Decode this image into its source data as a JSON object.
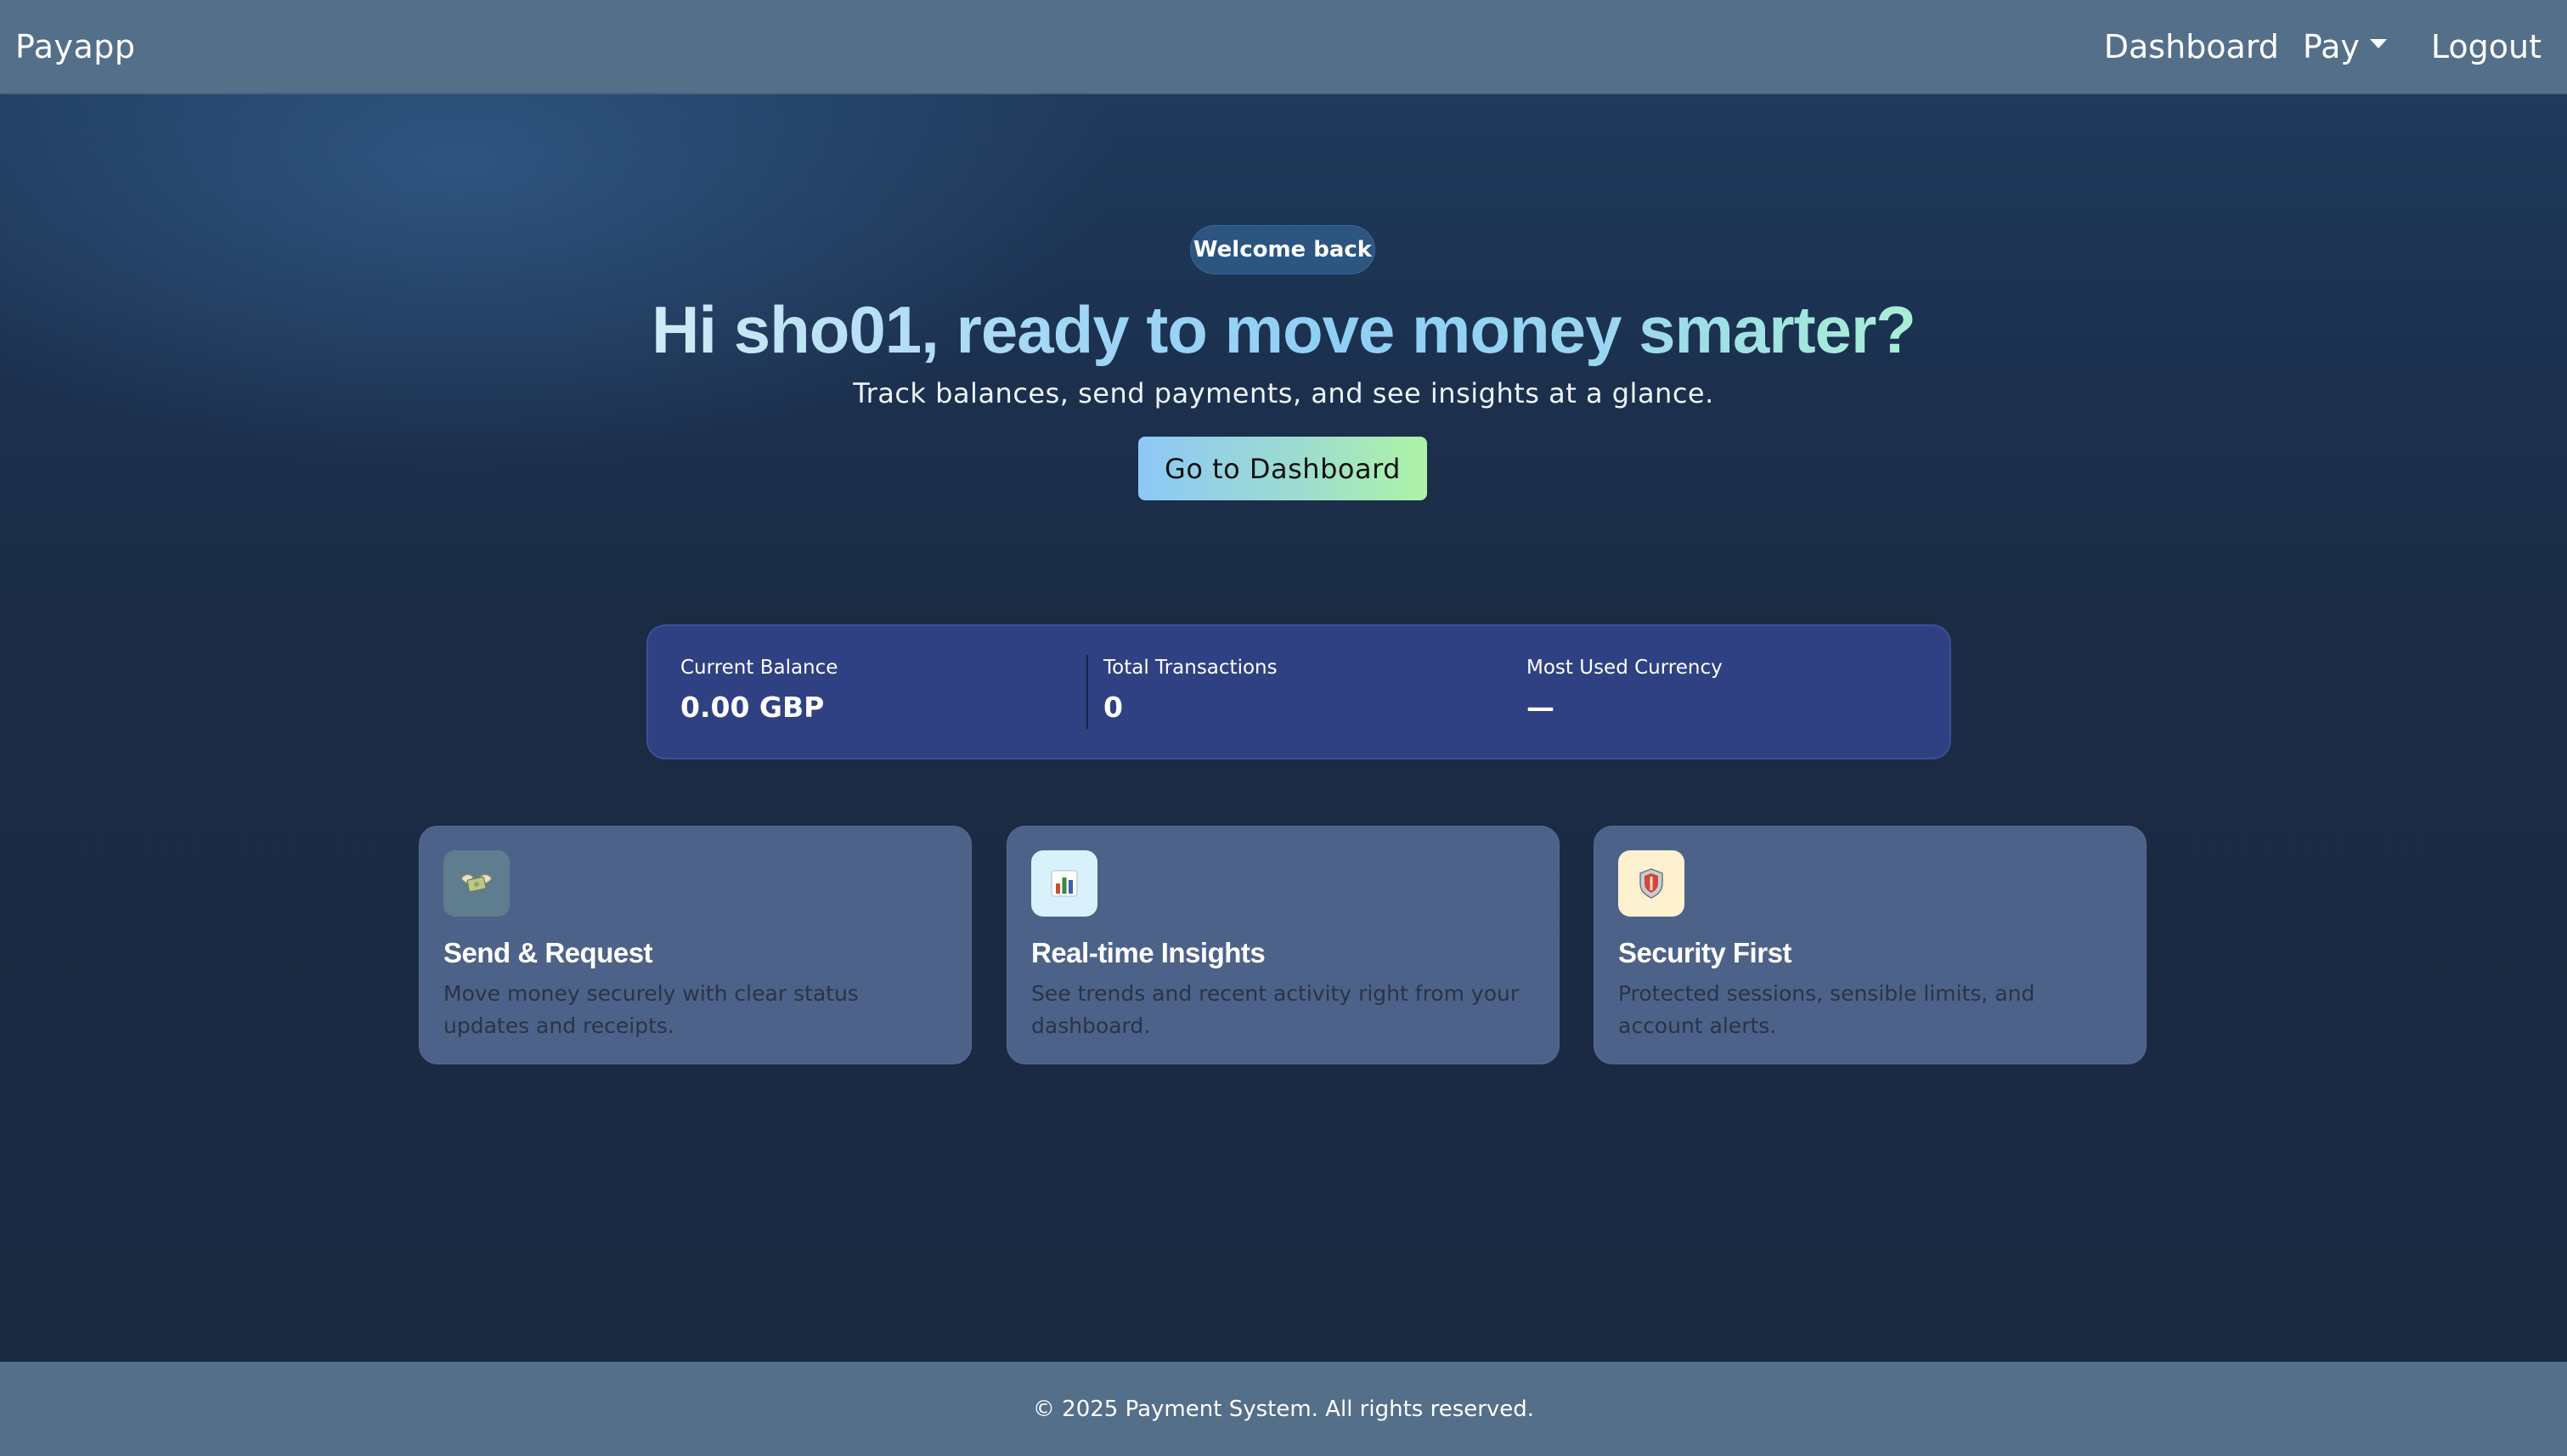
{
  "navbar": {
    "brand": "Payapp",
    "links": {
      "dashboard": "Dashboard",
      "pay": "Pay",
      "logout": "Logout"
    }
  },
  "hero": {
    "badge": "Welcome back",
    "title": "Hi sho01, ready to move money smarter?",
    "subtitle": "Track balances, send payments, and see insights at a glance.",
    "cta_label": "Go to Dashboard"
  },
  "stats": [
    {
      "label": "Current Balance",
      "value": "0.00 GBP"
    },
    {
      "label": "Total Transactions",
      "value": "0"
    },
    {
      "label": "Most Used Currency",
      "value": "—"
    }
  ],
  "features": [
    {
      "icon": "money-with-wings-icon",
      "title": "Send & Request",
      "description": "Move money securely with clear status updates and receipts."
    },
    {
      "icon": "bar-chart-icon",
      "title": "Real-time Insights",
      "description": "See trends and recent activity right from your dashboard."
    },
    {
      "icon": "shield-icon",
      "title": "Security First",
      "description": "Protected sessions, sensible limits, and account alerts."
    }
  ],
  "footer": {
    "text": "© 2025 Payment System. All rights reserved."
  },
  "colors": {
    "navbar_bg": "#546f89",
    "page_bg": "#1b2a41",
    "stats_bg": "#2f4182",
    "card_bg": "#4d6288",
    "cta_gradient_start": "#8cc8f7",
    "cta_gradient_end": "#aef3a6"
  }
}
